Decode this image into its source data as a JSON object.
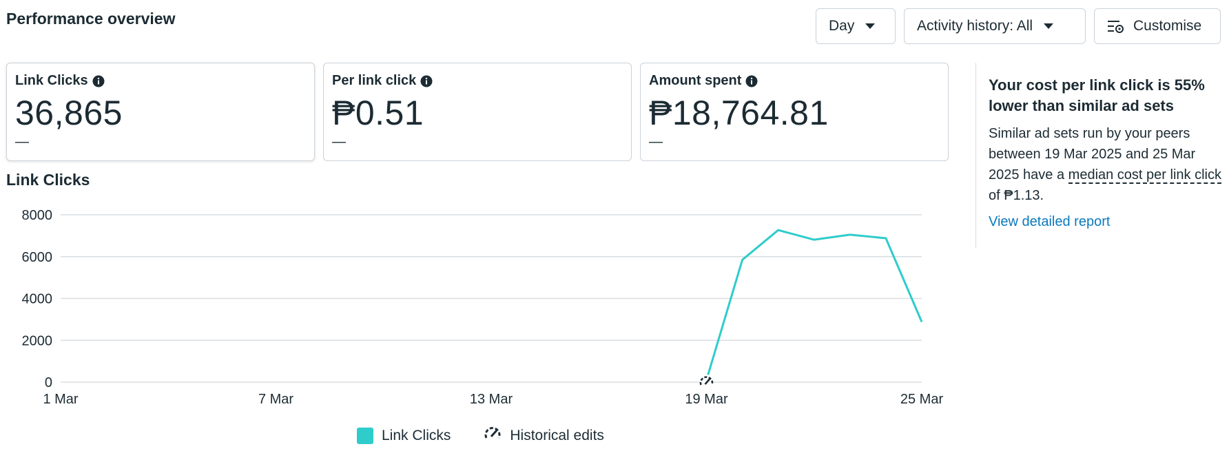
{
  "header": {
    "title": "Performance overview",
    "day_label": "Day",
    "activity_label": "Activity history: All",
    "customise_label": "Customise"
  },
  "metrics": [
    {
      "label": "Link Clicks",
      "value": "36,865",
      "delta": "—"
    },
    {
      "label": "Per link click",
      "value": "₱0.51",
      "delta": "—"
    },
    {
      "label": "Amount spent",
      "value": "₱18,764.81",
      "delta": "—"
    }
  ],
  "chart_title": "Link Clicks",
  "chart_data": {
    "type": "line",
    "x": [
      "19 Mar",
      "20 Mar",
      "21 Mar",
      "22 Mar",
      "23 Mar",
      "24 Mar",
      "25 Mar"
    ],
    "series": [
      {
        "name": "Link Clicks",
        "color": "#2ecccb",
        "values": [
          100,
          5850,
          7270,
          6810,
          7050,
          6880,
          2880
        ]
      }
    ],
    "x_ticks": [
      "1 Mar",
      "7 Mar",
      "13 Mar",
      "19 Mar",
      "25 Mar"
    ],
    "y_ticks": [
      0,
      2000,
      4000,
      6000,
      8000
    ],
    "ylim": [
      0,
      8000
    ],
    "grid": true,
    "historical_edit_at": "19 Mar"
  },
  "legend": {
    "series_label": "Link Clicks",
    "edits_label": "Historical edits"
  },
  "insight": {
    "title": "Your cost per link click is 55% lower than similar ad sets",
    "body_prefix": "Similar ad sets run by your peers between 19 Mar 2025 and 25 Mar 2025 have a ",
    "body_term": "median cost per link click",
    "body_suffix": " of ₱1.13.",
    "link": "View detailed report"
  },
  "colors": {
    "accent": "#2ecccb",
    "link": "#0a78be",
    "text": "#1c2b33",
    "grid": "#dadde1"
  }
}
